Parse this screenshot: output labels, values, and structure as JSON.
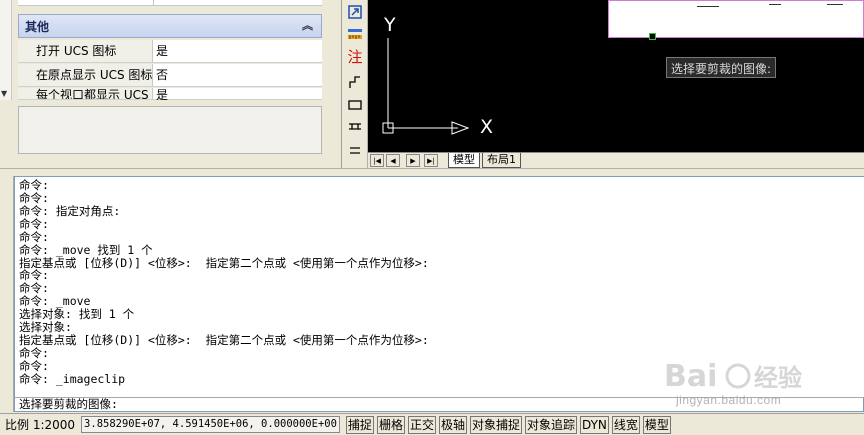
{
  "palette": {
    "section_title": "其他",
    "rows": [
      {
        "key": "打开 UCS 图标",
        "value": "是"
      },
      {
        "key": "在原点显示 UCS 图标",
        "value": "否"
      },
      {
        "key": "每个视口都显示 UCS",
        "value": "是"
      }
    ]
  },
  "toolbar": {
    "icons": [
      "zoom-extents-icon",
      "dimension-icon",
      "annotation-icon",
      "polyline-icon",
      "rectangle-icon",
      "hatch-icon",
      "more-icon"
    ],
    "annotation_label": "注"
  },
  "drawing": {
    "ucs_y_label": "Y",
    "ucs_x_label": "X",
    "tooltip": "选择要剪裁的图像:"
  },
  "tabs": {
    "model": "模型",
    "layout": "布局1"
  },
  "command": {
    "history": [
      "命令:",
      "命令:",
      "命令: 指定对角点:",
      "命令:",
      "命令:",
      "命令: _move 找到 1 个",
      "指定基点或 [位移(D)] <位移>:  指定第二个点或 <使用第一个点作为位移>:",
      "命令:",
      "命令:",
      "命令: _move",
      "选择对象: 找到 1 个",
      "选择对象:",
      "指定基点或 [位移(D)] <位移>:  指定第二个点或 <使用第一个点作为位移>:",
      "命令:",
      "命令:",
      "命令: _imageclip"
    ],
    "prompt": "选择要剪裁的图像:"
  },
  "watermark": {
    "site": "jingyan.baidu.com"
  },
  "status": {
    "scale": "比例  1:2000",
    "coords": "3.858290E+07, 4.591450E+06, 0.000000E+00",
    "buttons": [
      "捕捉",
      "栅格",
      "正交",
      "极轴",
      "对象捕捉",
      "对象追踪",
      "DYN",
      "线宽",
      "模型"
    ]
  }
}
